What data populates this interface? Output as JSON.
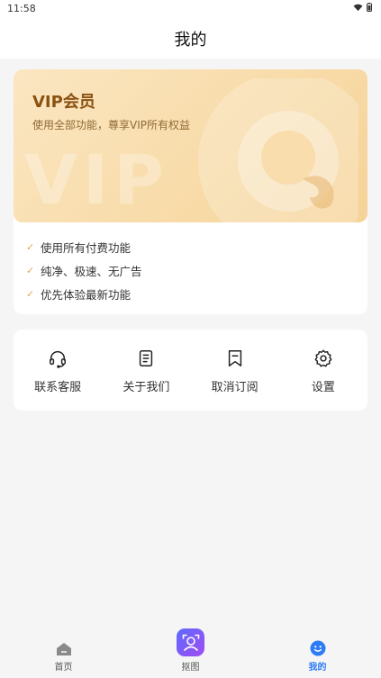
{
  "status_bar": {
    "time": "11:58",
    "icons": [
      "wifi-icon",
      "battery-icon"
    ]
  },
  "header": {
    "title": "我的"
  },
  "vip": {
    "title": "VIP会员",
    "subtitle": "使用全部功能，尊享VIP所有权益",
    "watermark": "VIP",
    "benefits": [
      "使用所有付费功能",
      "纯净、极速、无广告",
      "优先体验最新功能"
    ]
  },
  "services": [
    {
      "label": "联系客服",
      "icon": "headset-icon"
    },
    {
      "label": "关于我们",
      "icon": "document-icon"
    },
    {
      "label": "取消订阅",
      "icon": "bookmark-icon"
    },
    {
      "label": "设置",
      "icon": "gear-icon"
    }
  ],
  "tabs": [
    {
      "label": "首页",
      "icon": "home-icon",
      "active": false
    },
    {
      "label": "抠图",
      "icon": "cutout-icon",
      "active": false
    },
    {
      "label": "我的",
      "icon": "smiley-icon",
      "active": true
    }
  ],
  "colors": {
    "accent": "#2f7bf5",
    "vip_text": "#8a5212",
    "check": "#e3a857"
  }
}
